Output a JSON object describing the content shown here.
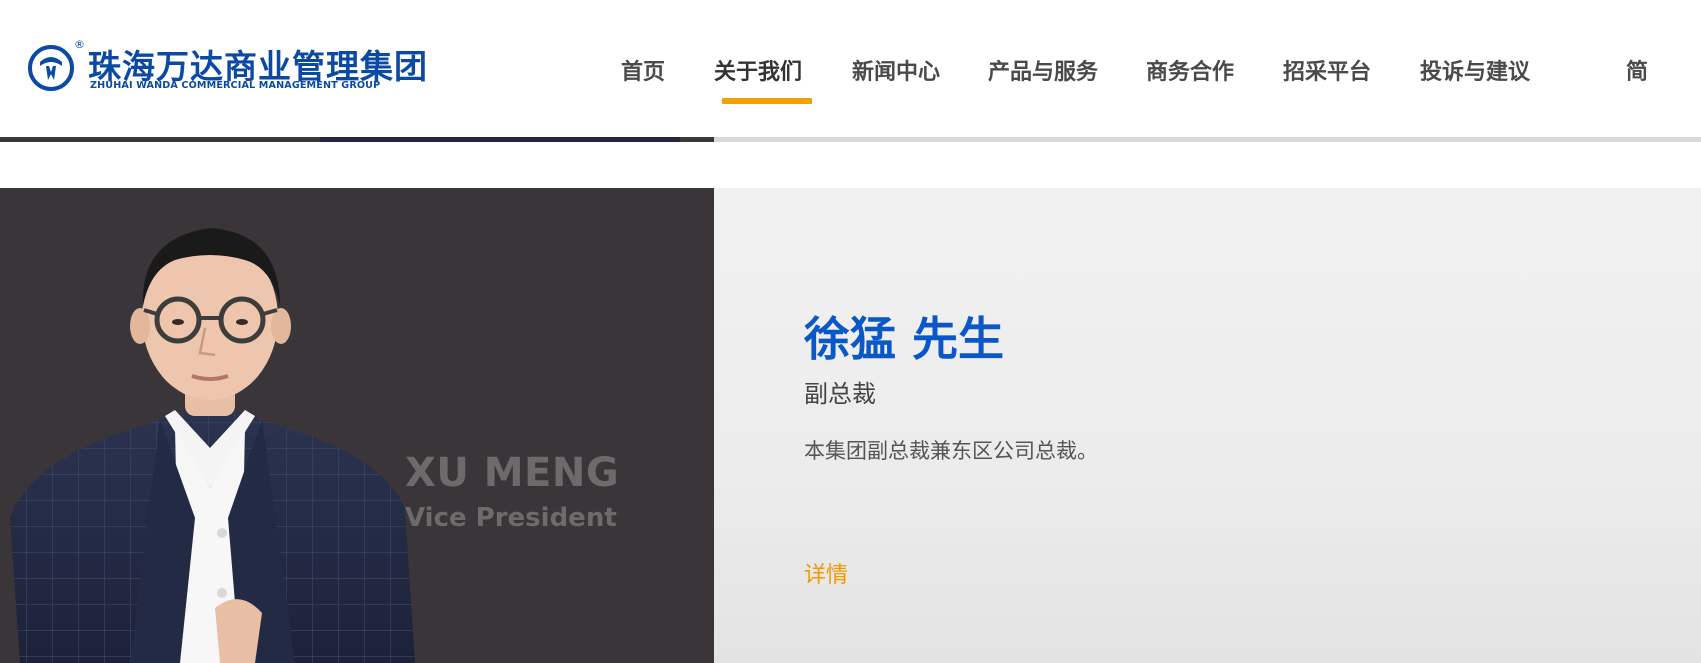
{
  "logo": {
    "registered_mark": "®",
    "cn_name": "珠海万达商业管理集团",
    "en_name": "ZHUHAI WANDA COMMERCIAL MANAGEMENT GROUP",
    "brand_color": "#0a4aa6"
  },
  "nav": {
    "items": [
      {
        "label": "首页"
      },
      {
        "label": "关于我们",
        "active": true
      },
      {
        "label": "新闻中心"
      },
      {
        "label": "产品与服务"
      },
      {
        "label": "商务合作"
      },
      {
        "label": "招采平台"
      },
      {
        "label": "投诉与建议"
      },
      {
        "label": "简"
      }
    ],
    "active_color": "#f0a000"
  },
  "profile": {
    "en_name": "XU MENG",
    "en_title": "Vice President",
    "cn_name": "徐猛 先生",
    "cn_title": "副总裁",
    "bio": "本集团副总裁兼东区公司总裁。",
    "detail_link": "详情",
    "name_color": "#0a57c8",
    "link_color": "#f29a00"
  }
}
